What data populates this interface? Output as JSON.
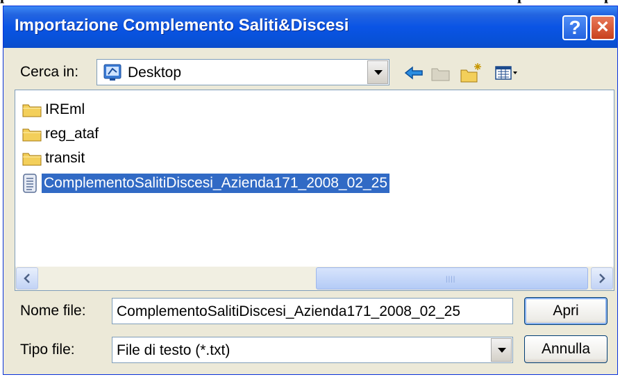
{
  "background_text": [
    "p",
    "p",
    "p"
  ],
  "window": {
    "title": "Importazione Complemento Saliti&Discesi",
    "help_button": "?",
    "close_button": "×"
  },
  "lookin": {
    "label": "Cerca in:",
    "value": "Desktop",
    "icon": "desktop-icon"
  },
  "toolbar": {
    "icons": [
      "back-arrow-icon",
      "up-folder-icon",
      "new-folder-icon",
      "view-menu-icon"
    ]
  },
  "files": [
    {
      "name": "IREml",
      "icon": "folder-icon",
      "selected": false
    },
    {
      "name": "reg_ataf",
      "icon": "folder-icon",
      "selected": false
    },
    {
      "name": "transit",
      "icon": "folder-icon",
      "selected": false
    },
    {
      "name": "ComplementoSalitiDiscesi_Azienda171_2008_02_25",
      "icon": "text-file-icon",
      "selected": true
    }
  ],
  "filename": {
    "label": "Nome file:",
    "value": "ComplementoSalitiDiscesi_Azienda171_2008_02_25"
  },
  "filetype": {
    "label": "Tipo file:",
    "value": "File di testo (*.txt)"
  },
  "buttons": {
    "open": "Apri",
    "cancel": "Annulla"
  },
  "colors": {
    "titlebar": "#0a54e5",
    "selection": "#316ac5",
    "dialog_bg": "#ece9d8"
  }
}
